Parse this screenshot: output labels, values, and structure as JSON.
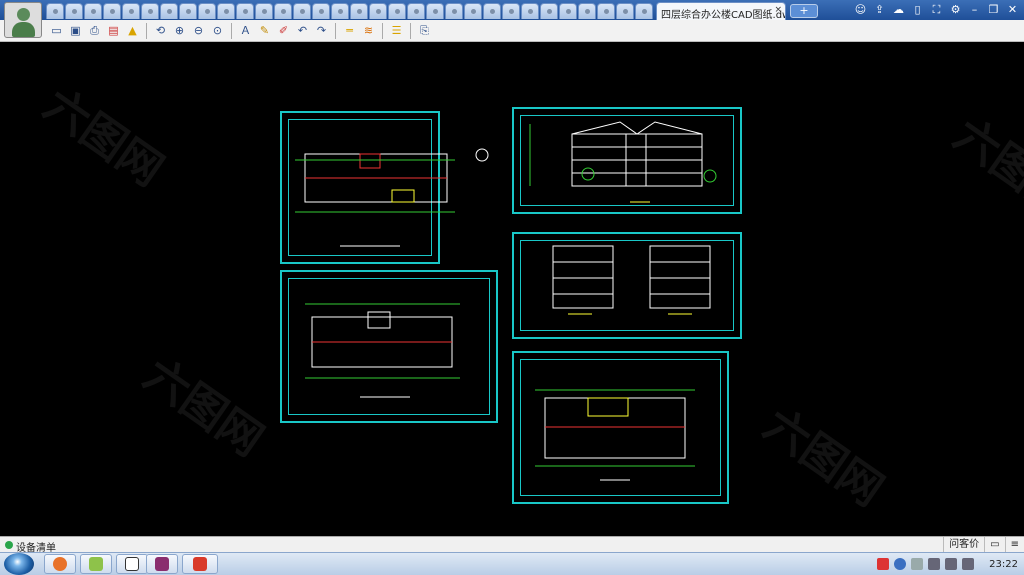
{
  "tabs": {
    "active_title": "四层综合办公楼CAD图纸.dwg",
    "close_glyph": "×",
    "new_tab_glyph": "+"
  },
  "toolbar": {
    "icons": [
      "open-icon",
      "save-icon",
      "print-icon",
      "pdf-icon",
      "lock-icon",
      "zoom-extents-icon",
      "zoom-in-icon",
      "zoom-out-icon",
      "zoom-window-icon",
      "text-icon",
      "pen-icon",
      "marker-icon",
      "undo-icon",
      "redo-icon",
      "measure-icon",
      "dimension-icon",
      "layers-icon",
      "export-icon"
    ]
  },
  "window_controls": [
    "user-icon",
    "share-icon",
    "cloud-icon",
    "mobile-icon",
    "fullscreen-icon",
    "settings-icon",
    "minimize-icon",
    "restore-icon",
    "close-icon"
  ],
  "canvas": {
    "watermark_text": "六图网",
    "accent_color": "#19c7c7"
  },
  "statusbar": {
    "text": "设备清单",
    "right_label": "问客价"
  },
  "taskbar": {
    "clock": "23:22"
  }
}
